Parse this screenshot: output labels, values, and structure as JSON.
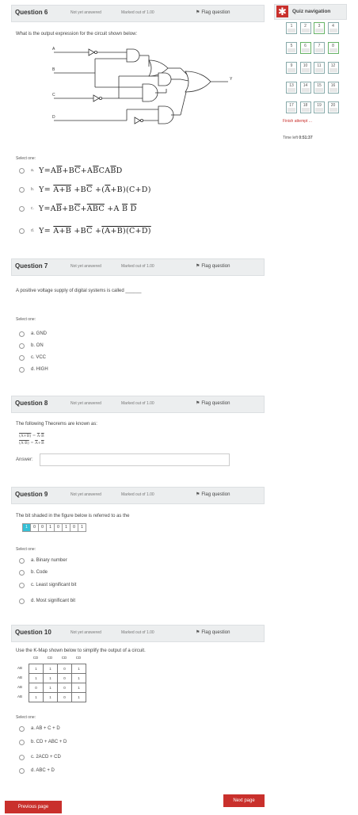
{
  "nav": {
    "title": "Quiz navigation",
    "cells": [
      "1",
      "2",
      "3",
      "4",
      "5",
      "6",
      "7",
      "8",
      "9",
      "10",
      "11",
      "12",
      "13",
      "14",
      "15",
      "16",
      "17",
      "18",
      "19",
      "20"
    ],
    "finish": "Finish attempt ...",
    "time_label": "Time left",
    "time_value": "0:51:37"
  },
  "q6": {
    "title": "Question 6",
    "status": "Not yet answered",
    "marks": "Marked out of 1.00",
    "flag": "Flag question",
    "text": "What is the output expression for the circuit shown below:",
    "inputs": [
      "A",
      "B",
      "C",
      "D"
    ],
    "output": "Y",
    "select": "Select one:",
    "options": [
      {
        "letter": "a."
      },
      {
        "letter": "b."
      },
      {
        "letter": "c."
      },
      {
        "letter": "d."
      }
    ]
  },
  "q7": {
    "title": "Question 7",
    "status": "Not yet answered",
    "marks": "Marked out of 1.00",
    "flag": "Flag question",
    "text": "A positive voltage supply of digital systems is called ______",
    "select": "Select one:",
    "options": [
      "a. GND",
      "b. ON",
      "c. VCC",
      "d. HIGH"
    ]
  },
  "q8": {
    "title": "Question 8",
    "status": "Not yet answered",
    "marks": "Marked out of 1.00",
    "flag": "Flag question",
    "text": "The following Theorems are known as:",
    "answer_label": "Answer:"
  },
  "q9": {
    "title": "Question 9",
    "status": "Not yet answered",
    "marks": "Marked out of 1.00",
    "flag": "Flag question",
    "text": "The bit shaded in the figure below is referred to as the",
    "bits": [
      "1",
      "0",
      "0",
      "1",
      "0",
      "1",
      "0",
      "1"
    ],
    "select": "Select one:",
    "options": [
      "a. Binary number",
      "b. Code",
      "c. Least significant bit",
      "d. Most significant bit"
    ]
  },
  "q10": {
    "title": "Question 10",
    "status": "Not yet answered",
    "marks": "Marked out of 1.00",
    "flag": "Flag question",
    "text": "Use the K-Map shown below to simplify the output of a circuit.",
    "cols": [
      "CD",
      "CD",
      "CD",
      "CD"
    ],
    "rows": [
      "AB",
      "AB",
      "AB",
      "AB"
    ],
    "cells": [
      [
        "1",
        "1",
        "0",
        "1"
      ],
      [
        "1",
        "1",
        "0",
        "1"
      ],
      [
        "0",
        "1",
        "0",
        "1"
      ],
      [
        "1",
        "1",
        "0",
        "1"
      ]
    ],
    "select": "Select one:",
    "options": [
      "a. AB + C + D",
      "b. CD + ABC + D",
      "c. 2ACD + CD",
      "d. ABC + D"
    ]
  },
  "footer": {
    "prev": "Previous page",
    "next": "Next page"
  },
  "colors": {
    "accent": "#c9302c",
    "nav_border": "#7a9a9a",
    "answered": "#66b366"
  }
}
